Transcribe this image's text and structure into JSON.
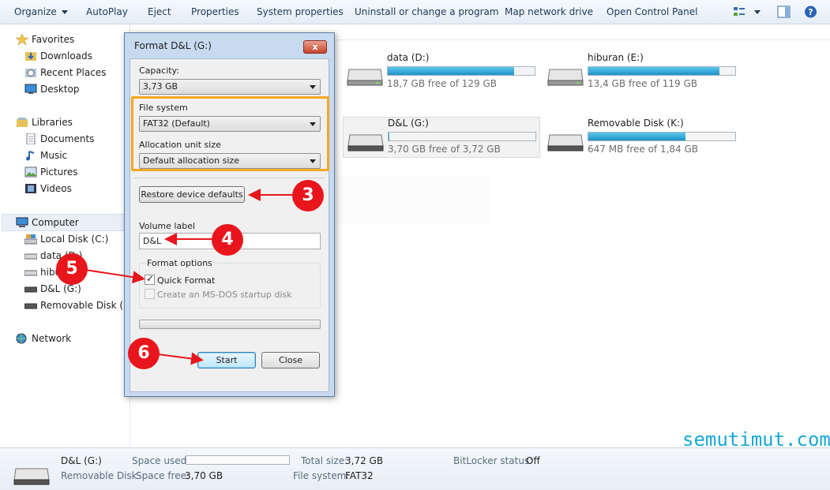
{
  "toolbar": {
    "items": [
      "Organize",
      "AutoPlay",
      "Eject",
      "Properties",
      "System properties",
      "Uninstall or change a program",
      "Map network drive",
      "Open Control Panel"
    ]
  },
  "sidebar": {
    "favorites": "Favorites",
    "downloads": "Downloads",
    "recent_places": "Recent Places",
    "desktop": "Desktop",
    "libraries": "Libraries",
    "documents": "Documents",
    "music": "Music",
    "pictures": "Pictures",
    "videos": "Videos",
    "computer": "Computer",
    "local_disk": "Local Disk (C:)",
    "data": "data (D:)",
    "hiburan": "hibu",
    "dl": "D&L (G:)",
    "removable": "Removable Disk (K:)",
    "network": "Network"
  },
  "drives": [
    {
      "name": "data (D:)",
      "free": "18,7 GB free of 129 GB",
      "used_fraction": 0.86
    },
    {
      "name": "hiburan (E:)",
      "free": "13,4 GB free of 119 GB",
      "used_fraction": 0.89
    },
    {
      "name": "D&L (G:)",
      "free": "3,70 GB free of 3,72 GB",
      "used_fraction": 0.005
    },
    {
      "name": "Removable Disk (K:)",
      "free": "647 MB free of 1,84 GB",
      "used_fraction": 0.66
    }
  ],
  "dialog": {
    "title": "Format D&L (G:)",
    "close_glyph": "x",
    "capacity_label": "Capacity:",
    "capacity_value": "3,73 GB",
    "filesystem_label": "File system",
    "filesystem_value": "FAT32 (Default)",
    "allocation_label": "Allocation unit size",
    "allocation_value": "Default allocation size",
    "restore_button": "Restore device defaults",
    "volume_label": "Volume label",
    "volume_value": "D&L",
    "format_options": "Format options",
    "quick_format": "Quick Format",
    "msdos_disk": "Create an MS-DOS startup disk",
    "start_button": "Start",
    "close_button": "Close"
  },
  "annotations": {
    "m3": "3",
    "m4": "4",
    "m5": "5",
    "m6": "6"
  },
  "details": {
    "name": "D&L (G:)",
    "type": "Removable Disk",
    "space_used_label": "Space used:",
    "space_free_label": "Space free:",
    "space_free_value": "3,70 GB",
    "total_size_label": "Total size:",
    "total_size_value": "3,72 GB",
    "file_system_label": "File system:",
    "file_system_value": "FAT32",
    "bitlocker_label": "BitLocker status:",
    "bitlocker_value": "Off"
  },
  "watermark": "semutimut.com",
  "colors": {
    "accent_highlight": "#f5a623",
    "marker": "#e8151c",
    "drive_bar": "#1e91c7"
  }
}
